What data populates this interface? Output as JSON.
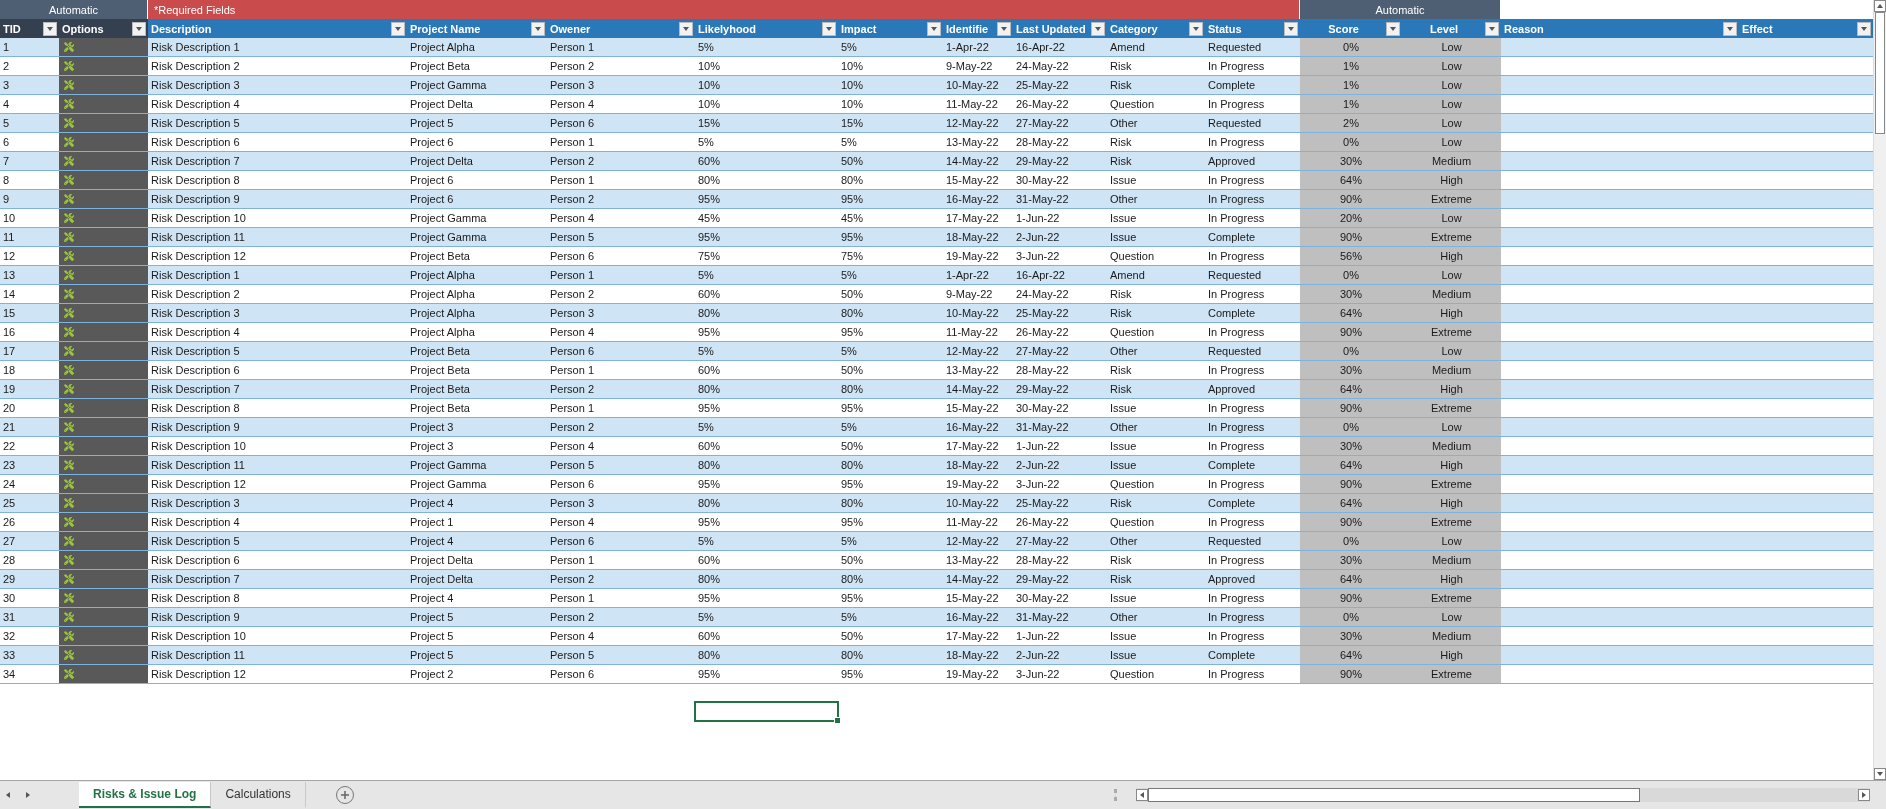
{
  "column_groups": [
    {
      "label": "Automatic",
      "kind": "auto",
      "columns": [
        {
          "label": "TID",
          "kind": "text"
        },
        {
          "label": "Options",
          "kind": "options"
        }
      ]
    },
    {
      "label": "*Required Fields",
      "kind": "required",
      "columns": [
        {
          "label": "Description",
          "kind": "text"
        },
        {
          "label": "Project Name",
          "kind": "text"
        },
        {
          "label": "Owener",
          "kind": "text"
        },
        {
          "label": "Likelyhood",
          "kind": "text"
        },
        {
          "label": "Impact",
          "kind": "text"
        },
        {
          "label": "Identifie",
          "kind": "text"
        },
        {
          "label": "Last Updated",
          "kind": "text"
        },
        {
          "label": "Category",
          "kind": "text"
        },
        {
          "label": "Status",
          "kind": "text"
        }
      ]
    },
    {
      "label": "Automatic",
      "kind": "auto",
      "columns": [
        {
          "label": "Score",
          "kind": "auto"
        },
        {
          "label": "Level",
          "kind": "auto"
        }
      ]
    },
    {
      "kind": "plain",
      "columns": [
        {
          "label": "Reason",
          "kind": "text"
        },
        {
          "label": "Effect",
          "kind": "text"
        }
      ]
    }
  ],
  "rows": [
    [
      "1",
      "Risk Description 1",
      "Project Alpha",
      "Person 1",
      "5%",
      "5%",
      "1-Apr-22",
      "16-Apr-22",
      "Amend",
      "Requested",
      "0%",
      "Low"
    ],
    [
      "2",
      "Risk Description 2",
      "Project Beta",
      "Person 2",
      "10%",
      "10%",
      "9-May-22",
      "24-May-22",
      "Risk",
      "In Progress",
      "1%",
      "Low"
    ],
    [
      "3",
      "Risk Description 3",
      "Project Gamma",
      "Person 3",
      "10%",
      "10%",
      "10-May-22",
      "25-May-22",
      "Risk",
      "Complete",
      "1%",
      "Low"
    ],
    [
      "4",
      "Risk Description 4",
      "Project Delta",
      "Person 4",
      "10%",
      "10%",
      "11-May-22",
      "26-May-22",
      "Question",
      "In Progress",
      "1%",
      "Low"
    ],
    [
      "5",
      "Risk Description 5",
      "Project 5",
      "Person 6",
      "15%",
      "15%",
      "12-May-22",
      "27-May-22",
      "Other",
      "Requested",
      "2%",
      "Low"
    ],
    [
      "6",
      "Risk Description 6",
      "Project 6",
      "Person 1",
      "5%",
      "5%",
      "13-May-22",
      "28-May-22",
      "Risk",
      "In Progress",
      "0%",
      "Low"
    ],
    [
      "7",
      "Risk Description 7",
      "Project Delta",
      "Person 2",
      "60%",
      "50%",
      "14-May-22",
      "29-May-22",
      "Risk",
      "Approved",
      "30%",
      "Medium"
    ],
    [
      "8",
      "Risk Description 8",
      "Project 6",
      "Person 1",
      "80%",
      "80%",
      "15-May-22",
      "30-May-22",
      "Issue",
      "In Progress",
      "64%",
      "High"
    ],
    [
      "9",
      "Risk Description 9",
      "Project 6",
      "Person 2",
      "95%",
      "95%",
      "16-May-22",
      "31-May-22",
      "Other",
      "In Progress",
      "90%",
      "Extreme"
    ],
    [
      "10",
      "Risk Description 10",
      "Project Gamma",
      "Person 4",
      "45%",
      "45%",
      "17-May-22",
      "1-Jun-22",
      "Issue",
      "In Progress",
      "20%",
      "Low"
    ],
    [
      "11",
      "Risk Description 11",
      "Project Gamma",
      "Person 5",
      "95%",
      "95%",
      "18-May-22",
      "2-Jun-22",
      "Issue",
      "Complete",
      "90%",
      "Extreme"
    ],
    [
      "12",
      "Risk Description 12",
      "Project Beta",
      "Person 6",
      "75%",
      "75%",
      "19-May-22",
      "3-Jun-22",
      "Question",
      "In Progress",
      "56%",
      "High"
    ],
    [
      "13",
      "Risk Description 1",
      "Project Alpha",
      "Person 1",
      "5%",
      "5%",
      "1-Apr-22",
      "16-Apr-22",
      "Amend",
      "Requested",
      "0%",
      "Low"
    ],
    [
      "14",
      "Risk Description 2",
      "Project Alpha",
      "Person 2",
      "60%",
      "50%",
      "9-May-22",
      "24-May-22",
      "Risk",
      "In Progress",
      "30%",
      "Medium"
    ],
    [
      "15",
      "Risk Description 3",
      "Project Alpha",
      "Person 3",
      "80%",
      "80%",
      "10-May-22",
      "25-May-22",
      "Risk",
      "Complete",
      "64%",
      "High"
    ],
    [
      "16",
      "Risk Description 4",
      "Project Alpha",
      "Person 4",
      "95%",
      "95%",
      "11-May-22",
      "26-May-22",
      "Question",
      "In Progress",
      "90%",
      "Extreme"
    ],
    [
      "17",
      "Risk Description 5",
      "Project Beta",
      "Person 6",
      "5%",
      "5%",
      "12-May-22",
      "27-May-22",
      "Other",
      "Requested",
      "0%",
      "Low"
    ],
    [
      "18",
      "Risk Description 6",
      "Project Beta",
      "Person 1",
      "60%",
      "50%",
      "13-May-22",
      "28-May-22",
      "Risk",
      "In Progress",
      "30%",
      "Medium"
    ],
    [
      "19",
      "Risk Description 7",
      "Project Beta",
      "Person 2",
      "80%",
      "80%",
      "14-May-22",
      "29-May-22",
      "Risk",
      "Approved",
      "64%",
      "High"
    ],
    [
      "20",
      "Risk Description 8",
      "Project Beta",
      "Person 1",
      "95%",
      "95%",
      "15-May-22",
      "30-May-22",
      "Issue",
      "In Progress",
      "90%",
      "Extreme"
    ],
    [
      "21",
      "Risk Description 9",
      "Project 3",
      "Person 2",
      "5%",
      "5%",
      "16-May-22",
      "31-May-22",
      "Other",
      "In Progress",
      "0%",
      "Low"
    ],
    [
      "22",
      "Risk Description 10",
      "Project 3",
      "Person 4",
      "60%",
      "50%",
      "17-May-22",
      "1-Jun-22",
      "Issue",
      "In Progress",
      "30%",
      "Medium"
    ],
    [
      "23",
      "Risk Description 11",
      "Project Gamma",
      "Person 5",
      "80%",
      "80%",
      "18-May-22",
      "2-Jun-22",
      "Issue",
      "Complete",
      "64%",
      "High"
    ],
    [
      "24",
      "Risk Description 12",
      "Project Gamma",
      "Person 6",
      "95%",
      "95%",
      "19-May-22",
      "3-Jun-22",
      "Question",
      "In Progress",
      "90%",
      "Extreme"
    ],
    [
      "25",
      "Risk Description 3",
      "Project 4",
      "Person 3",
      "80%",
      "80%",
      "10-May-22",
      "25-May-22",
      "Risk",
      "Complete",
      "64%",
      "High"
    ],
    [
      "26",
      "Risk Description 4",
      "Project 1",
      "Person 4",
      "95%",
      "95%",
      "11-May-22",
      "26-May-22",
      "Question",
      "In Progress",
      "90%",
      "Extreme"
    ],
    [
      "27",
      "Risk Description 5",
      "Project 4",
      "Person 6",
      "5%",
      "5%",
      "12-May-22",
      "27-May-22",
      "Other",
      "Requested",
      "0%",
      "Low"
    ],
    [
      "28",
      "Risk Description 6",
      "Project Delta",
      "Person 1",
      "60%",
      "50%",
      "13-May-22",
      "28-May-22",
      "Risk",
      "In Progress",
      "30%",
      "Medium"
    ],
    [
      "29",
      "Risk Description 7",
      "Project Delta",
      "Person 2",
      "80%",
      "80%",
      "14-May-22",
      "29-May-22",
      "Risk",
      "Approved",
      "64%",
      "High"
    ],
    [
      "30",
      "Risk Description 8",
      "Project 4",
      "Person 1",
      "95%",
      "95%",
      "15-May-22",
      "30-May-22",
      "Issue",
      "In Progress",
      "90%",
      "Extreme"
    ],
    [
      "31",
      "Risk Description 9",
      "Project 5",
      "Person 2",
      "5%",
      "5%",
      "16-May-22",
      "31-May-22",
      "Other",
      "In Progress",
      "0%",
      "Low"
    ],
    [
      "32",
      "Risk Description 10",
      "Project 5",
      "Person 4",
      "60%",
      "50%",
      "17-May-22",
      "1-Jun-22",
      "Issue",
      "In Progress",
      "30%",
      "Medium"
    ],
    [
      "33",
      "Risk Description 11",
      "Project 5",
      "Person 5",
      "80%",
      "80%",
      "18-May-22",
      "2-Jun-22",
      "Issue",
      "Complete",
      "64%",
      "High"
    ],
    [
      "34",
      "Risk Description 12",
      "Project 2",
      "Person 6",
      "95%",
      "95%",
      "19-May-22",
      "3-Jun-22",
      "Question",
      "In Progress",
      "90%",
      "Extreme"
    ]
  ],
  "selection": {
    "visible": true
  },
  "tabs": [
    {
      "label": "Risks & Issue Log",
      "selected": true
    },
    {
      "label": "Calculations",
      "selected": false
    }
  ]
}
